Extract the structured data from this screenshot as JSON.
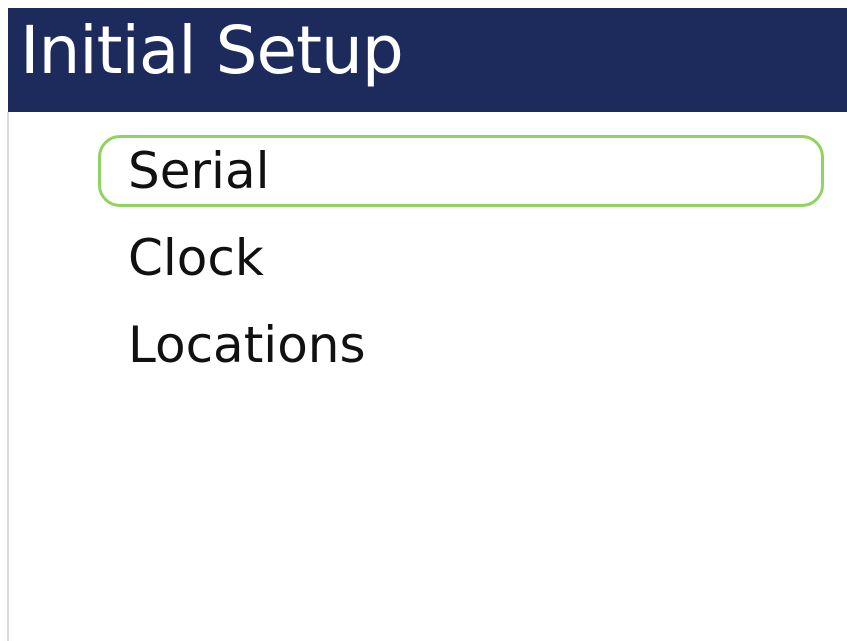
{
  "header": {
    "title": "Initial Setup",
    "background_color": "#1c2b5b",
    "text_color": "#ffffff"
  },
  "menu": {
    "selected_index": 0,
    "selection_color": "#8fd460",
    "items": [
      {
        "label": "Serial",
        "selected": true
      },
      {
        "label": "Clock",
        "selected": false
      },
      {
        "label": "Locations",
        "selected": false
      }
    ]
  }
}
